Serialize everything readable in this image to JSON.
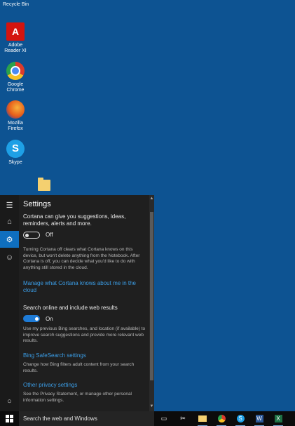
{
  "desktop": {
    "recycle_bin": "Recycle Bin",
    "icons": [
      {
        "label": "Adobe Reader XI",
        "glyph": "A"
      },
      {
        "label": "Google Chrome",
        "glyph": ""
      },
      {
        "label": "Mozilla Firefox",
        "glyph": ""
      },
      {
        "label": "Skype",
        "glyph": "S"
      }
    ]
  },
  "cortana": {
    "title": "Settings",
    "rail_icons": [
      "hamburger-icon",
      "home-icon",
      "gear-icon",
      "feedback-icon",
      "cortana-circle-icon"
    ],
    "suggestions_text": "Cortana can give you suggestions, ideas, reminders, alerts and more.",
    "suggestions_toggle": "Off",
    "off_info": "Turning Cortana off clears what Cortana knows on this device, but won't delete anything from the Notebook. After Cortana is off, you can decide what you'd like to do with anything still stored in the cloud.",
    "manage_link": "Manage what Cortana knows about me in the cloud",
    "web_search_text": "Search online and include web results",
    "web_search_toggle": "On",
    "web_search_info": "Use my previous Bing searches, and location (if available) to improve search suggestions and provide more relevant web results.",
    "safesearch_link": "Bing SafeSearch settings",
    "safesearch_info": "Change how Bing filters adult content from your search results.",
    "privacy_link": "Other privacy settings",
    "privacy_info": "See the Privacy Statement, or manage other personal information settings."
  },
  "taskbar": {
    "search_placeholder": "Search the web and Windows",
    "apps": [
      "task-view-icon",
      "snipping-tool-icon",
      "file-explorer-icon",
      "chrome-icon",
      "skype-icon",
      "word-icon",
      "excel-icon"
    ]
  },
  "colors": {
    "accent": "#0f6fbf",
    "link": "#3b9de6",
    "desktop": "#0d5392"
  }
}
